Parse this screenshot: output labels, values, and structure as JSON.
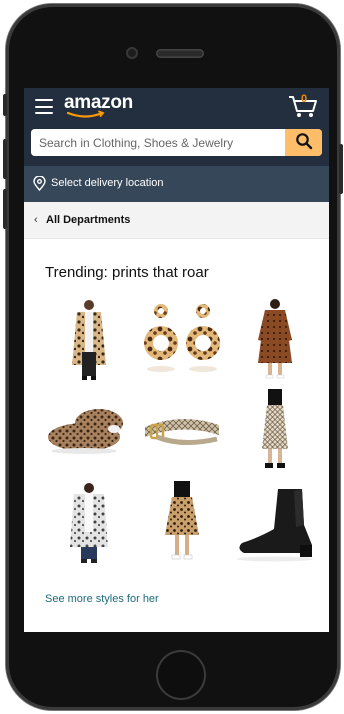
{
  "header": {
    "logo_text": "amazon",
    "cart_count": "0",
    "accent_color": "#febd69",
    "bar_color": "#232f3e"
  },
  "search": {
    "placeholder": "Search in Clothing, Shoes & Jewelry"
  },
  "delivery": {
    "label": "Select delivery location"
  },
  "departments": {
    "label": "All Departments"
  },
  "trending": {
    "title": "Trending: prints that roar",
    "products": [
      {
        "icon": "leopard-cardigan"
      },
      {
        "icon": "tortoise-earrings"
      },
      {
        "icon": "leopard-dress"
      },
      {
        "icon": "leopard-slippers"
      },
      {
        "icon": "snakeskin-belt"
      },
      {
        "icon": "snakeskin-skirt"
      },
      {
        "icon": "gray-leopard-cardigan"
      },
      {
        "icon": "leopard-skirt"
      },
      {
        "icon": "black-ankle-boot"
      }
    ],
    "see_more": "See more styles for her"
  }
}
